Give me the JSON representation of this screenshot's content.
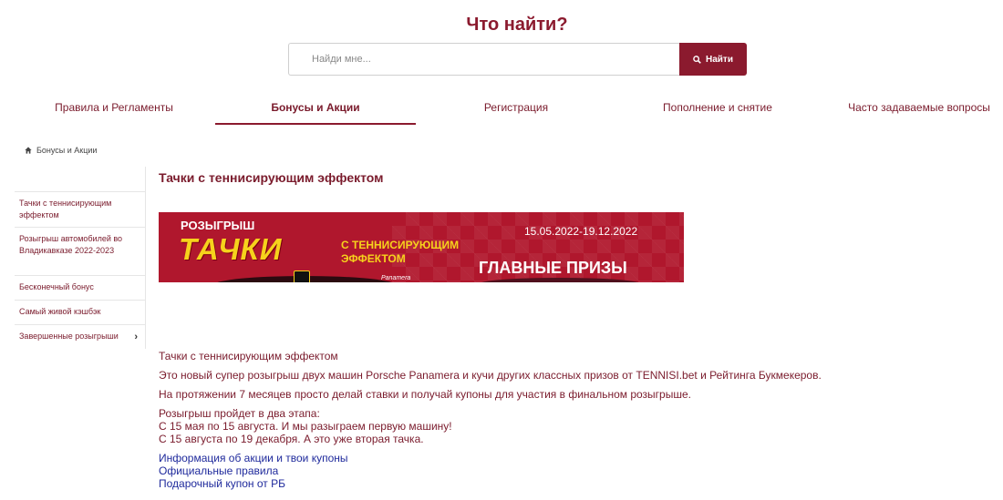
{
  "header": {
    "title": "Что найти?"
  },
  "search": {
    "placeholder": "Найди мне...",
    "button_label": "Найти"
  },
  "nav": {
    "tabs": [
      {
        "label": "Правила и Регламенты"
      },
      {
        "label": "Бонусы и Акции",
        "active": true
      },
      {
        "label": "Регистрация"
      },
      {
        "label": "Пополнение и снятие"
      },
      {
        "label": "Часто задаваемые вопросы"
      }
    ]
  },
  "breadcrumb": {
    "label": "Бонусы и Акции",
    "icon": "home-icon"
  },
  "sidebar": {
    "items": [
      {
        "label": "Тачки с теннисирующим эффектом"
      },
      {
        "label": "Розыгрыш автомобилей во Владикавказе 2022-2023"
      },
      {
        "label": "Бесконечный бонус"
      },
      {
        "label": "Самый живой кэшбэк"
      },
      {
        "label": "Завершенные розыгрыши",
        "has_submenu": true
      }
    ]
  },
  "main": {
    "title": "Тачки с теннисирующим эффектом",
    "banner": {
      "raffle": "РОЗЫГРЫШ",
      "headline": "ТАЧКИ",
      "subline1": "С ТЕННИСИРУЮЩИМ",
      "subline2": "ЭФФЕКТОМ",
      "dates": "15.05.2022-19.12.2022",
      "prizes": "ГЛАВНЫЕ ПРИЗЫ",
      "car_brand": "Panamera"
    },
    "intro_title": "Тачки с теннисирующим эффектом",
    "p1": "Это новый супер розыгрыш двух машин Porsche Panamera и кучи других классных призов от TENNISI.bet и Рейтинга Букмекеров.",
    "p2": "На протяжении 7 месяцев просто делай ставки и получай купоны для участия в финальном розыгрыше.",
    "p3_line1": "Розыгрыш пройдет в два этапа:",
    "p3_line2": "С 15 мая по 15 августа. И мы разыграем первую машину!",
    "p3_line3": "С 15 августа по 19 декабря. А это уже вторая тачка.",
    "links": [
      "Информация об акции и твои купоны",
      "Официальные правила",
      "Подарочный купон от РБ"
    ]
  },
  "colors": {
    "accent": "#8b1a2e",
    "link": "#1f2a9c",
    "banner_bg": "#b0172d",
    "banner_yellow": "#f6d21c"
  }
}
